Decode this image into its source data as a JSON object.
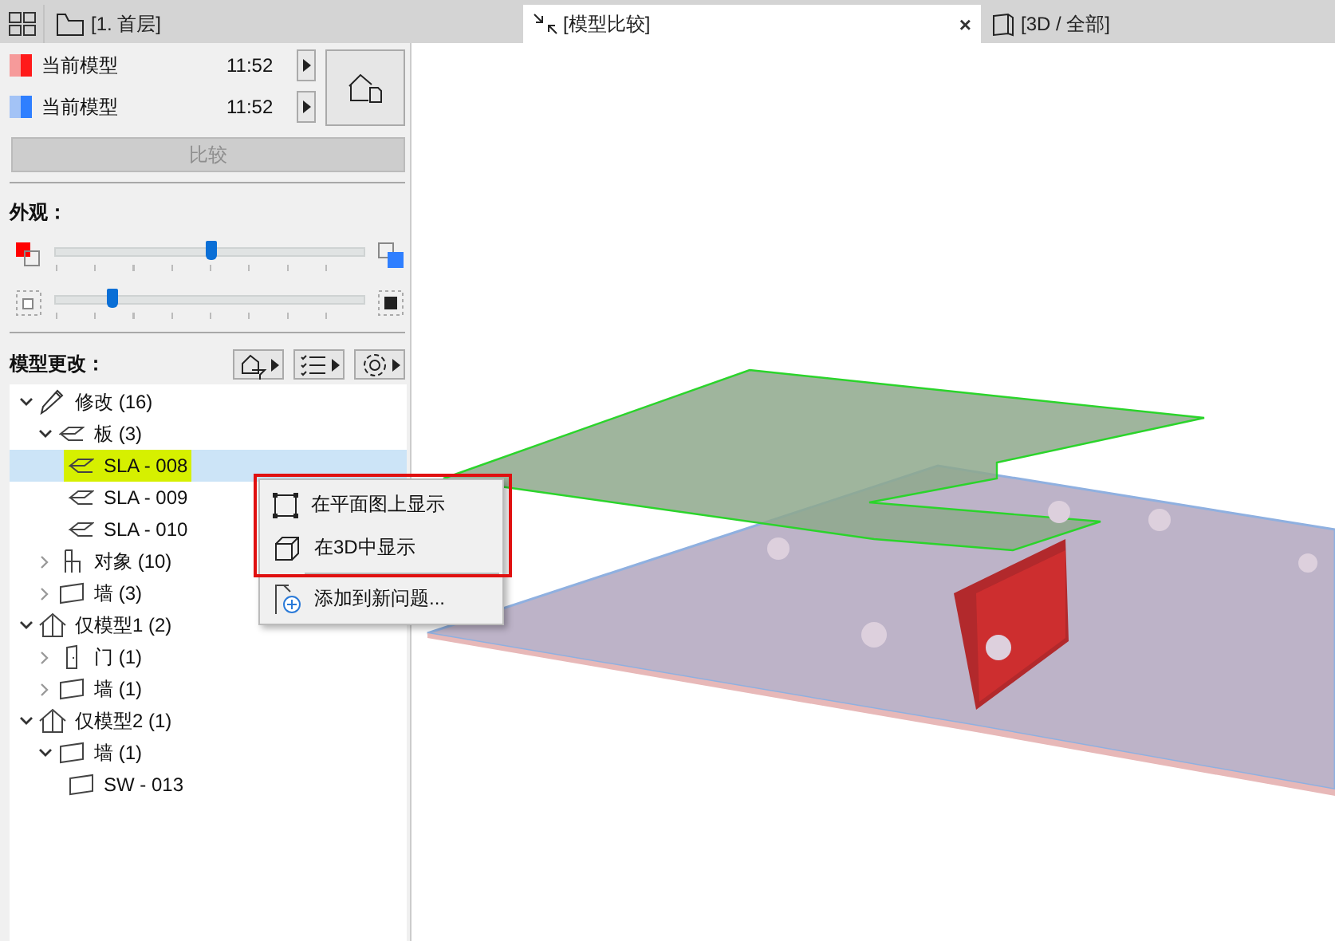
{
  "tabs": [
    {
      "label": "[1. 首层]",
      "selected": false
    },
    {
      "label": "[模型比较]",
      "selected": true,
      "close_glyph": "×"
    },
    {
      "label": "[3D / 全部]",
      "selected": false
    }
  ],
  "models": [
    {
      "name": "当前模型",
      "time": "11:52",
      "color": "#ff1a1a"
    },
    {
      "name": "当前模型",
      "time": "11:52",
      "color": "#2f7fff"
    }
  ],
  "compare_button": {
    "label": "比较",
    "disabled": true
  },
  "appearance": {
    "title": "外观：",
    "sliders": [
      {
        "kind": "color",
        "level": 0.5
      },
      {
        "kind": "detail",
        "level": 0.18
      }
    ]
  },
  "changes": {
    "title": "模型更改："
  },
  "tree": [
    {
      "label": "修改 (16)",
      "kind": "modified",
      "expanded": true,
      "children": [
        {
          "label": "板 (3)",
          "kind": "slab",
          "expanded": true,
          "children": [
            {
              "label": "SLA - 008",
              "kind": "slab",
              "selected": true,
              "highlighted": true
            },
            {
              "label": "SLA - 009",
              "kind": "slab",
              "selected": false,
              "highlighted": false
            },
            {
              "label": "SLA - 010",
              "kind": "slab",
              "selected": false,
              "highlighted": false
            }
          ]
        },
        {
          "label": "对象 (10)",
          "kind": "object",
          "expanded": false
        },
        {
          "label": "墙 (3)",
          "kind": "wall",
          "expanded": false
        }
      ]
    },
    {
      "label": "仅模型1 (2)",
      "kind": "model",
      "expanded": true,
      "children": [
        {
          "label": "门 (1)",
          "kind": "door",
          "expanded": false
        },
        {
          "label": "墙 (1)",
          "kind": "wall",
          "expanded": false
        }
      ]
    },
    {
      "label": "仅模型2 (1)",
      "kind": "model",
      "expanded": true,
      "children": [
        {
          "label": "墙 (1)",
          "kind": "wall",
          "expanded": true,
          "children": [
            {
              "label": "SW - 013",
              "kind": "wall",
              "selected": false,
              "highlighted": false
            }
          ]
        }
      ]
    }
  ],
  "context_menu": {
    "sections": [
      {
        "highlighted": true,
        "items": [
          {
            "label": "在平面图上显示"
          },
          {
            "label": "在3D中显示"
          }
        ]
      },
      {
        "highlighted": false,
        "items": [
          {
            "label": "添加到新问题..."
          }
        ]
      }
    ]
  }
}
